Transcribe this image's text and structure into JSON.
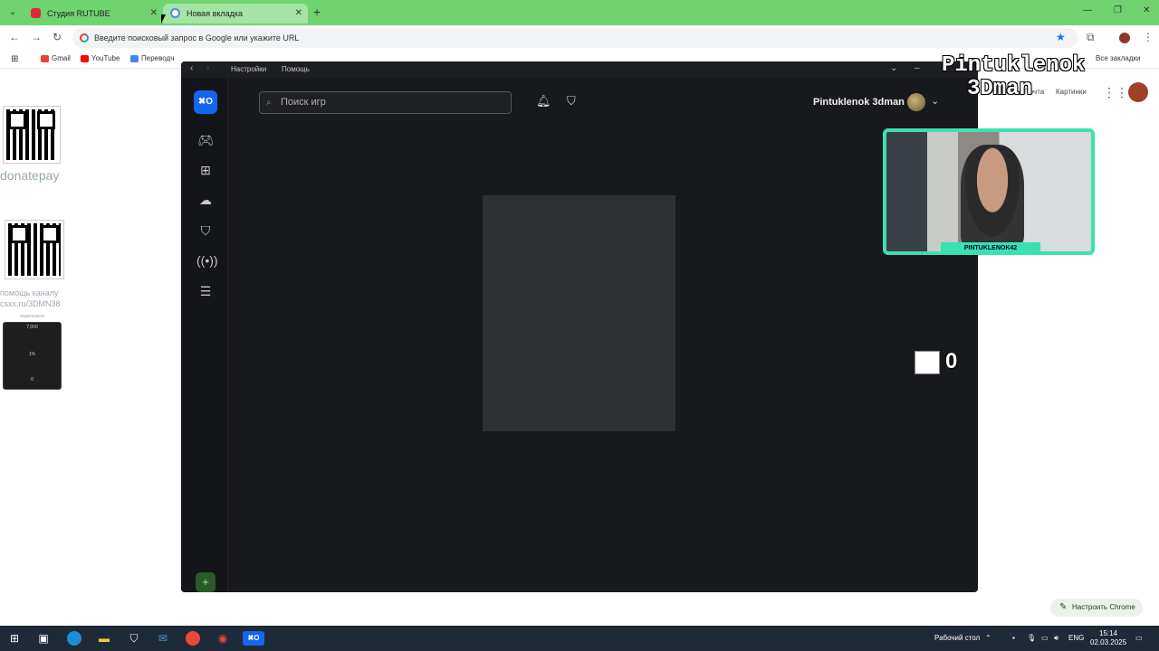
{
  "browser": {
    "tabs": [
      {
        "label": "Студия RUTUBE"
      },
      {
        "label": "Новая вкладка"
      }
    ],
    "omnibox_placeholder": "Введите поисковый запрос в Google или укажите URL",
    "bookmarks": [
      "Gmail",
      "YouTube",
      "Переводч"
    ],
    "right_links": [
      "Почта",
      "Картинки"
    ],
    "all_bookmarks": "Все закладки",
    "customize_label": "Настроить Chrome"
  },
  "desktop_overlay": {
    "donate_label": "donatepay",
    "help_text": "помощь каналу\ncsxx.ru/3DMN38",
    "card_top": "7,000",
    "card_mid": "1%",
    "card_bottom": "0",
    "card_caption": "видеокарта",
    "brand_line1": "Pintuklenok",
    "brand_line2": "3Dman",
    "cam_tag": "PINTUKLENOK42",
    "counter_value": "0"
  },
  "app": {
    "top_links": [
      "Настройки",
      "Помощь"
    ],
    "logo_text": "✖О",
    "search_placeholder": "Поиск игр",
    "username": "Pintuklenok 3dman"
  },
  "taskbar": {
    "desktop_label": "Рабочий стол",
    "lang": "ENG",
    "time": "15:14",
    "date": "02.03.2025"
  },
  "colors": {
    "chrome_green": "#6fd36f",
    "app_bg": "#18191c",
    "vk_blue": "#1466f0",
    "cam_border": "#3fe0b0"
  }
}
